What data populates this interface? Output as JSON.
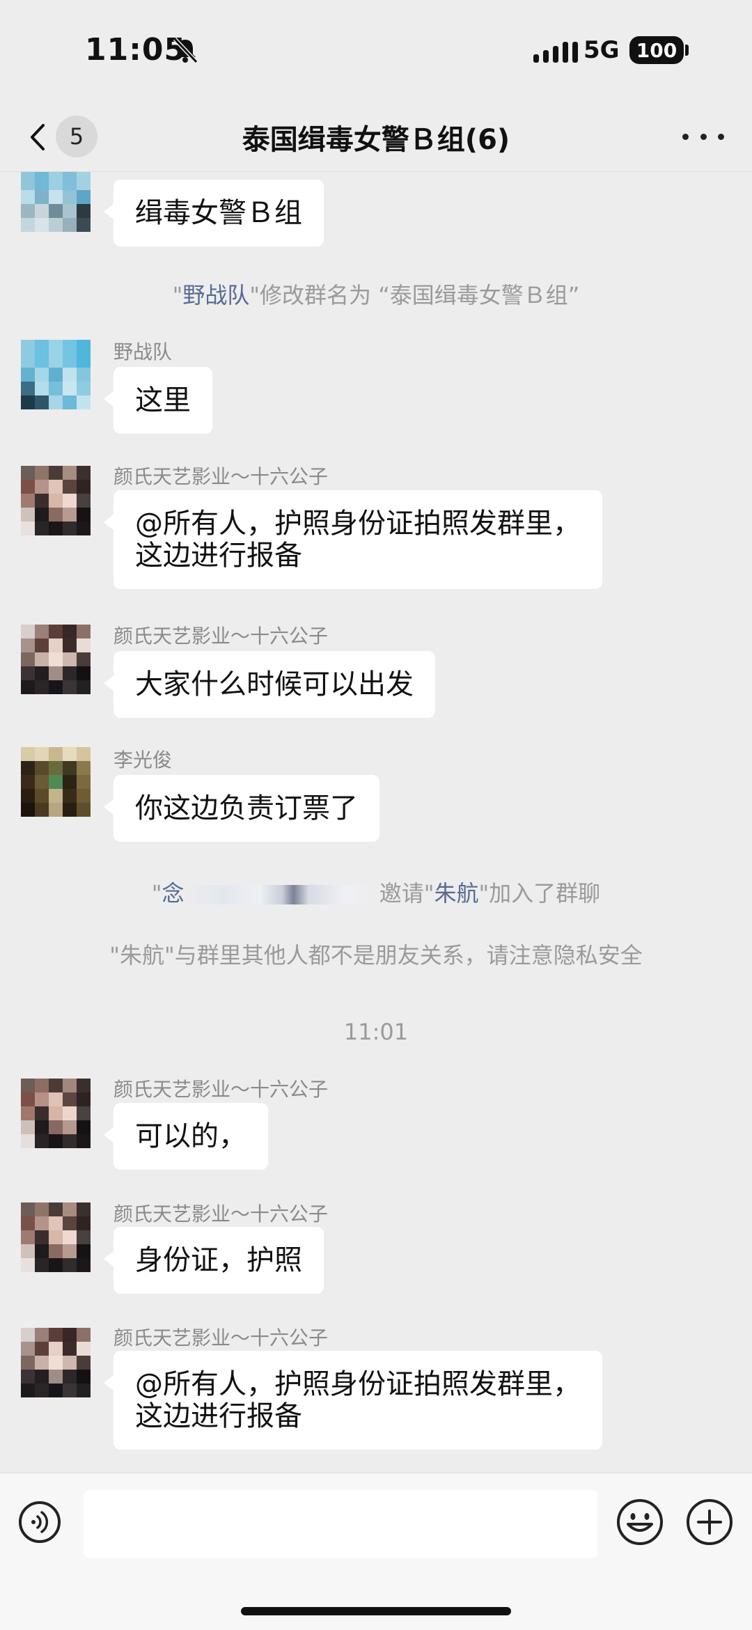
{
  "status_bar": {
    "time": "11:05",
    "network": "5G",
    "battery": "100"
  },
  "nav": {
    "back_count": "5",
    "title": "泰国缉毒女警Ｂ组(6)"
  },
  "messages": [
    {
      "text": "缉毒女警Ｂ组"
    },
    {
      "sender": "野战队",
      "text": "这里"
    },
    {
      "sender": "颜氏天艺影业～十六公子",
      "text": "@所有人，护照身份证拍照发群里，\n这边进行报备"
    },
    {
      "sender": "颜氏天艺影业～十六公子",
      "text": "大家什么时候可以出发"
    },
    {
      "sender": "李光俊",
      "text": "你这边负责订票了"
    },
    {
      "sender": "颜氏天艺影业～十六公子",
      "text": "可以的，"
    },
    {
      "sender": "颜氏天艺影业～十六公子",
      "text": "身份证，护照"
    },
    {
      "sender": "颜氏天艺影业～十六公子",
      "text": "@所有人，护照身份证拍照发群里，\n这边进行报备"
    }
  ],
  "system_messages": {
    "rename": {
      "q1": "\"",
      "name": "野战队",
      "rest": "\"修改群名为 “泰国缉毒女警Ｂ组”"
    },
    "invite": {
      "q1": "\"",
      "inviter": "念",
      "mid": " 邀请\"",
      "invitee": "朱航",
      "rest": "\"加入了群聊"
    },
    "privacy": "\"朱航\"与群里其他人都不是朋友关系，请注意隐私安全"
  },
  "time_divider": "11:01",
  "input": {
    "placeholder": ""
  },
  "icons": {
    "bell": "bell-slash-icon",
    "back": "chevron-left-icon",
    "more": "more-dots-icon",
    "voice": "voice-icon",
    "emoji": "emoji-icon",
    "plus": "plus-circle-icon"
  },
  "colors": {
    "background": "#ededed",
    "bubble": "#ffffff",
    "link": "#576b95",
    "system_text": "#9a9a9a"
  }
}
